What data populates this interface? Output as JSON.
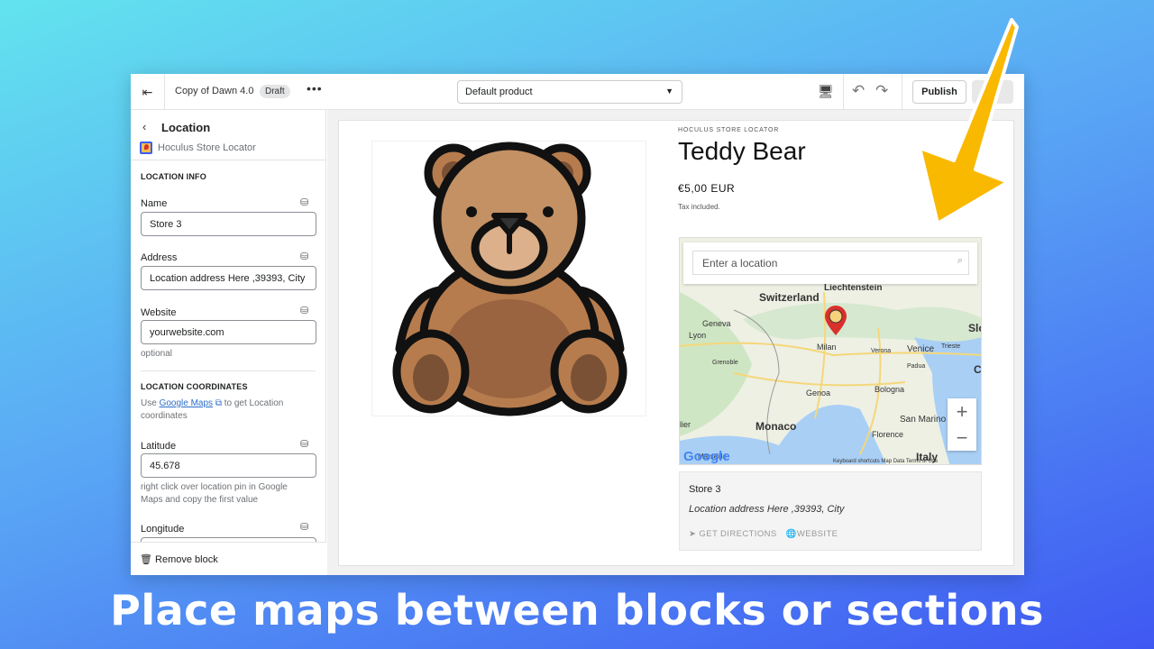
{
  "topbar": {
    "exit_icon": "exit-icon",
    "theme_name": "Copy of Dawn 4.0",
    "badge": "Draft",
    "more": "•••",
    "template_select": "Default product",
    "publish_label": "Publish"
  },
  "sidebar": {
    "back": "‹",
    "title": "Location",
    "app_name": "Hoculus Store Locator",
    "section_info": "LOCATION INFO",
    "name_label": "Name",
    "name_value": "Store 3",
    "address_label": "Address",
    "address_value": "Location address Here ,39393, City",
    "website_label": "Website",
    "website_value": "yourwebsite.com",
    "website_help": "optional",
    "section_coords": "LOCATION COORDINATES",
    "coords_help_pre": "Use ",
    "coords_help_link": "Google Maps",
    "coords_help_post": " to get Location coordinates",
    "latitude_label": "Latitude",
    "latitude_value": "45.678",
    "latitude_help": "right click over location pin in Google Maps and copy the first value",
    "longitude_label": "Longitude",
    "remove_block": "Remove block"
  },
  "product": {
    "vendor": "HOCULUS STORE LOCATOR",
    "title": "Teddy Bear",
    "price": "€5,00 EUR",
    "tax": "Tax included."
  },
  "map": {
    "search_placeholder": "Enter a location",
    "labels": [
      "Liechtenstein",
      "Switzerland",
      "Geneva",
      "Lyon",
      "Grenoble",
      "Milan",
      "Verona",
      "Venice",
      "Trieste",
      "Padua",
      "Genoa",
      "Bologna",
      "Monaco",
      "San Marino",
      "Florence",
      "Marseille",
      "Italy",
      "Slo",
      "lier",
      "C"
    ],
    "google": "Google",
    "footer": "Keyboard shortcuts   Map Data   Terms of Use",
    "zoom_in": "+",
    "zoom_out": "−"
  },
  "store_card": {
    "name": "Store 3",
    "address": "Location address Here ,39393, City",
    "directions": "GET DIRECTIONS",
    "website": "WEBSITE"
  },
  "caption": "Place maps between blocks or sections",
  "colors": {
    "arrow": "#f9b900",
    "link": "#2c6ecb",
    "pin": "#d9302c"
  }
}
